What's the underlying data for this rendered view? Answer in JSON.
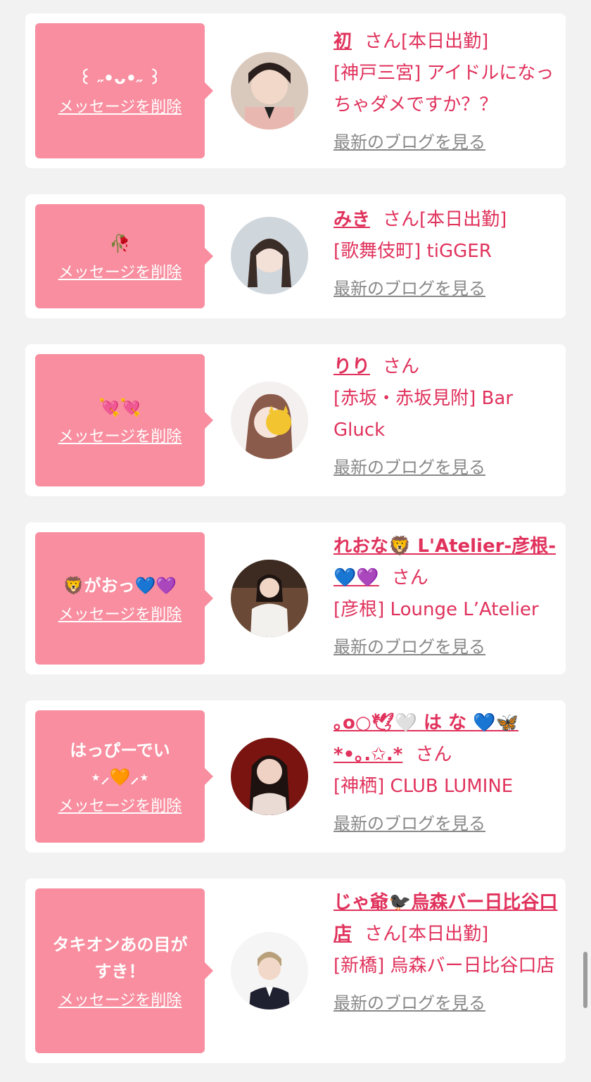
{
  "delete_label": "メッセージを削除",
  "blog_label": "最新のブログを見る",
  "san_label": "さん",
  "cards": [
    {
      "bubble_message": "꒰ ˶•ᴗ•˶ ꒱",
      "name": "初",
      "suffix": "[本日出勤]",
      "shop": "[神戸三宮] アイドルになっちゃダメですか？？"
    },
    {
      "bubble_message": "🥀",
      "name": "みき",
      "suffix": "[本日出勤]",
      "shop": "[歌舞伎町] tiGGER"
    },
    {
      "bubble_message": "💘💘",
      "name": "りり",
      "suffix": "",
      "shop": "[赤坂・赤坂見附] Bar Gluck"
    },
    {
      "bubble_message": "🦁がおっ💙💜",
      "name": "れおな🦁 L'Atelier-彦根-💙💜",
      "suffix": "",
      "shop": "[彦根] Lounge L’Atelier"
    },
    {
      "bubble_message": "はっぴーでい\n⋆⸝🧡⸝⋆",
      "name": "｡o○🕊🤍 は な 💙🦋 *•｡.✩.*",
      "suffix": "",
      "shop": "[神栖] CLUB LUMINE"
    },
    {
      "bubble_message": "タキオンあの目が\nすき！",
      "name": "じゃ爺🐦‍⬛烏森バー日比谷口店",
      "suffix": "[本日出勤]",
      "shop": "[新橋] 烏森バー日比谷口店"
    }
  ],
  "colors": {
    "page_bg": "#f2f2f2",
    "bubble": "#f88e9f",
    "accent": "#e0325c",
    "link_gray": "#888888"
  }
}
